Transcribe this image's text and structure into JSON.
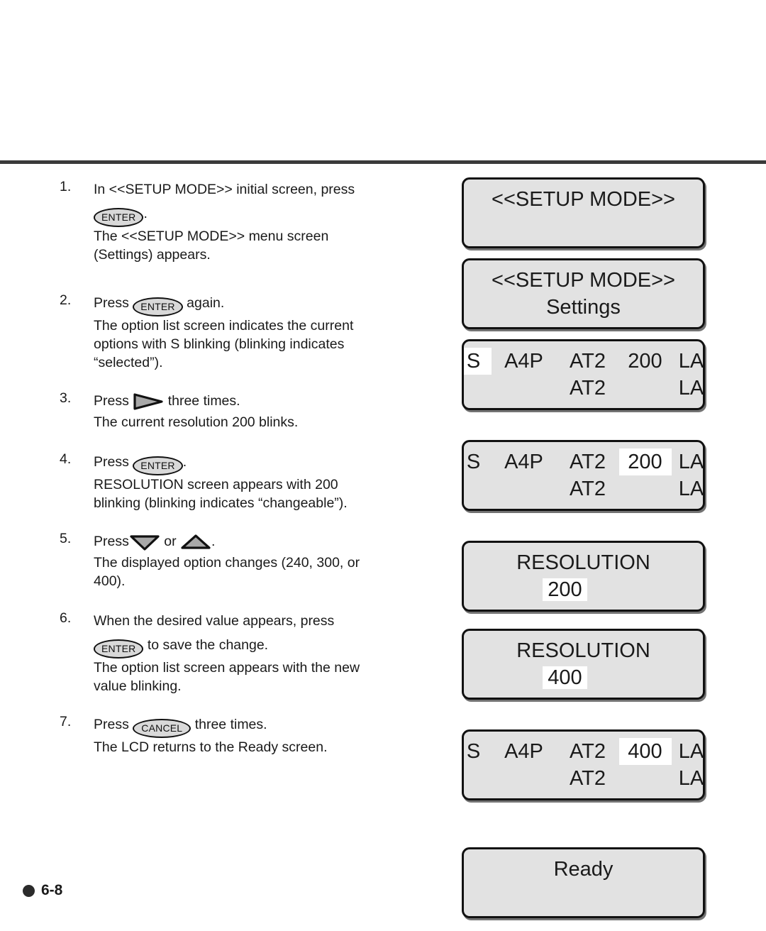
{
  "page": {
    "footer_page_number": "6-8"
  },
  "keys": {
    "enter": "ENTER",
    "cancel": "CANCEL",
    "right_arrow": "right-arrow-key",
    "down_arrow": "down-arrow-key",
    "up_arrow": "up-arrow-key"
  },
  "steps": [
    {
      "number": "1.",
      "line1_a": "In <<SETUP MODE>> initial screen, press",
      "line2_b": ".",
      "line3": "The <<SETUP MODE>> menu screen",
      "line4": "(Settings) appears."
    },
    {
      "number": "2.",
      "line1_a": "Press",
      "line1_b": "again.",
      "line2": "The option list screen indicates the current",
      "line3": "options with S blinking (blinking indicates",
      "line4": "“selected”)."
    },
    {
      "number": "3.",
      "line1_a": "Press",
      "line1_b": "three times.",
      "line2": "The current resolution 200 blinks."
    },
    {
      "number": "4.",
      "line1_a": "Press",
      "line1_b": ".",
      "line2": "RESOLUTION screen appears with 200",
      "line3": "blinking (blinking indicates “changeable”)."
    },
    {
      "number": "5.",
      "line1_a": "Press",
      "line1_b": "or",
      "line1_c": ".",
      "line2": "The displayed option changes (240, 300, or",
      "line3": "400)."
    },
    {
      "number": "6.",
      "line1": "When the desired value appears, press",
      "line2_b": "to save the change.",
      "line3": "The option list screen appears with the new",
      "line4": "value blinking."
    },
    {
      "number": "7.",
      "line1_a": "Press",
      "line1_b": "three times.",
      "line2": "The LCD returns to the Ready screen."
    }
  ],
  "lcd_screens": [
    {
      "id": "setup-mode-initial",
      "type": "text",
      "line1": "<<SETUP MODE>>",
      "line2": ""
    },
    {
      "id": "setup-mode-settings",
      "type": "text",
      "line1": "<<SETUP MODE>>",
      "line2": "Settings"
    },
    {
      "id": "option-list-s-blinking",
      "type": "option-list",
      "row1": [
        "S",
        "A4P",
        "AT2",
        "200",
        "LA"
      ],
      "row2": [
        "",
        "",
        "AT2",
        "",
        "LA"
      ],
      "highlight_row": 1,
      "highlight_col": 1,
      "highlight_value": "S"
    },
    {
      "id": "option-list-200-blinking",
      "type": "option-list",
      "row1": [
        "S",
        "A4P",
        "AT2",
        "200",
        "LA"
      ],
      "row2": [
        "",
        "",
        "AT2",
        "",
        "LA"
      ],
      "highlight_row": 1,
      "highlight_col": 4,
      "highlight_value": "200"
    },
    {
      "id": "resolution-200",
      "type": "resolution",
      "title": "RESOLUTION",
      "value": "200"
    },
    {
      "id": "resolution-400",
      "type": "resolution",
      "title": "RESOLUTION",
      "value": "400"
    },
    {
      "id": "option-list-400-blinking",
      "type": "option-list",
      "row1": [
        "S",
        "A4P",
        "AT2",
        "400",
        "LA"
      ],
      "row2": [
        "",
        "",
        "AT2",
        "",
        "LA"
      ],
      "highlight_row": 1,
      "highlight_col": 4,
      "highlight_value": "400"
    },
    {
      "id": "ready-screen",
      "type": "text",
      "line1": "Ready",
      "line2": ""
    }
  ],
  "colors": {
    "lcd_background": "#e2e2e2",
    "lcd_border": "#111111",
    "highlight": "#ffffff",
    "key_fill": "#d9d9d9",
    "arrow_fill": "#a8a8a8",
    "rule": "#3a3a3a"
  }
}
